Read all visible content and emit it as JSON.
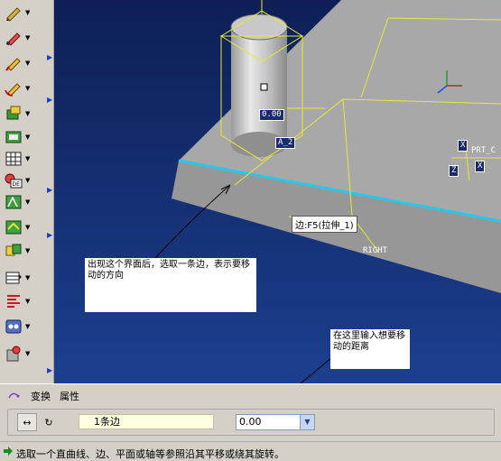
{
  "toolbar": {
    "icons": [
      "tool-1-icon",
      "tool-2-icon",
      "tool-3-icon",
      "tool-4-icon",
      "tool-5-icon",
      "tool-6-icon",
      "tool-7-icon",
      "tool-8-icon",
      "tool-9-icon",
      "tool-10-icon",
      "tool-11-icon",
      "tool-12-icon",
      "tool-13-icon",
      "tool-14-icon",
      "tool-15-icon",
      "tool-16-icon"
    ]
  },
  "viewport": {
    "datum_label": "0.00",
    "axis_label_a": "A_2",
    "csys_label": "PRT_C",
    "x_label": "X",
    "z_label": "Z",
    "x2_label": "X",
    "right_label": "RIGHT",
    "tooltip": "边:F5(拉伸_1)",
    "note_direction": "出现这个界面后，选取一条边，表示要移动的方向",
    "note_distance": "在这里输入想要移动的距离"
  },
  "dashboard": {
    "tab_transform": "变换",
    "tab_properties": "属性",
    "ref_value": "1条边",
    "distance_value": "0.00"
  },
  "status": {
    "message": "选取一个直曲线、边、平面或轴等参照沿其平移或绕其旋转。"
  },
  "colors": {
    "viewport_top": "#0d1f55",
    "viewport_bottom": "#1c3f8f",
    "part_gray": "#a8a8a8",
    "edge_highlight": "#29c7e8",
    "datum_yellow": "#e8e83a"
  }
}
